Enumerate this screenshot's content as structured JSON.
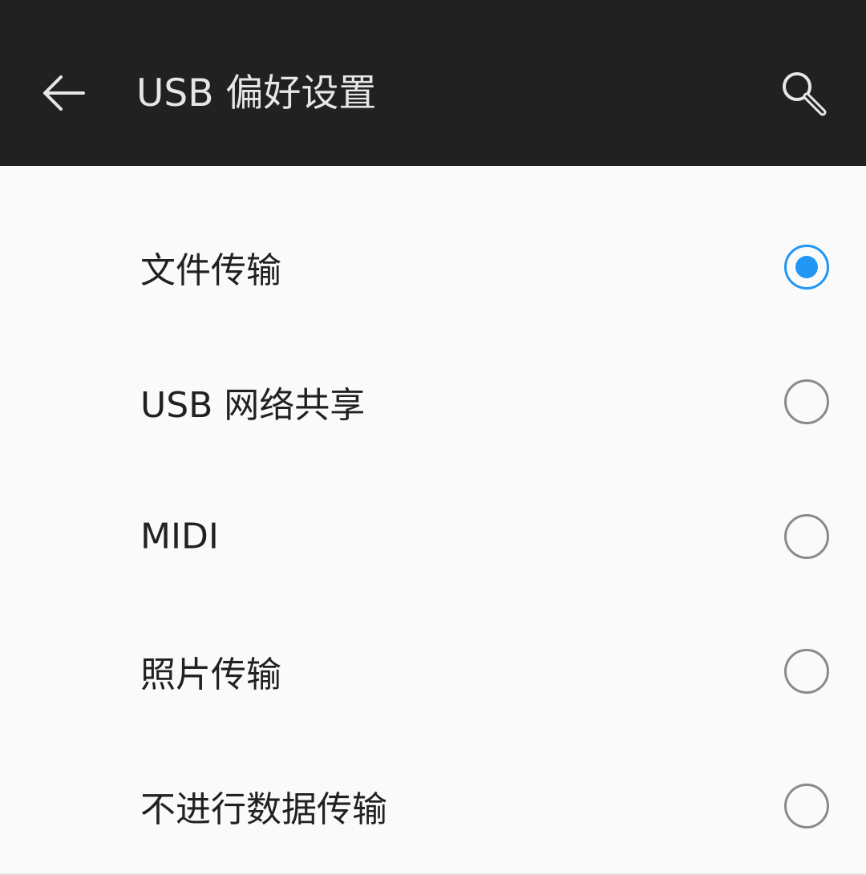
{
  "app_bar": {
    "title": "USB 偏好设置",
    "back_icon": "arrow-left-icon",
    "search_icon": "search-icon"
  },
  "options": [
    {
      "label": "文件传输",
      "selected": true
    },
    {
      "label": "USB 网络共享",
      "selected": false
    },
    {
      "label": "MIDI",
      "selected": false
    },
    {
      "label": "照片传输",
      "selected": false
    },
    {
      "label": "不进行数据传输",
      "selected": false
    }
  ],
  "colors": {
    "app_bar_bg": "#212121",
    "accent": "#2196f3",
    "background": "#fafafa"
  }
}
